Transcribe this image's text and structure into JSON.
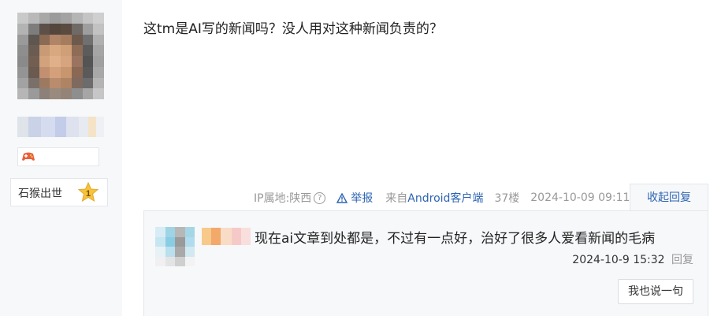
{
  "post": {
    "content": "这tm是AI写的新闻吗？没人用对这种新闻负责的？",
    "ip_label": "IP属地:陕西",
    "report_label": "举报",
    "from_prefix": "来自",
    "from_client": "Android客户端",
    "floor": "37楼",
    "time": "2024-10-09 09:11",
    "collapse_label": "收起回复"
  },
  "user": {
    "rank_title": "石猴出世",
    "rank_level": "1"
  },
  "reply": {
    "text": "现在ai文章到处都是，不过有一点好，治好了很多人爱看新闻的毛病",
    "time": "2024-10-9 15:32",
    "reply_label": "回复"
  },
  "say_button_label": "我也说一句",
  "colors": {
    "link_blue": "#2d64b3",
    "meta_gray": "#999999",
    "panel_bg": "#f7f8fa",
    "border": "#e3e6ea",
    "star_gold": "#f6c33b"
  },
  "icons": {
    "help": "help-circle-icon",
    "report": "warning-triangle-icon",
    "badge": "game-controller-icon",
    "rank": "star-icon"
  }
}
